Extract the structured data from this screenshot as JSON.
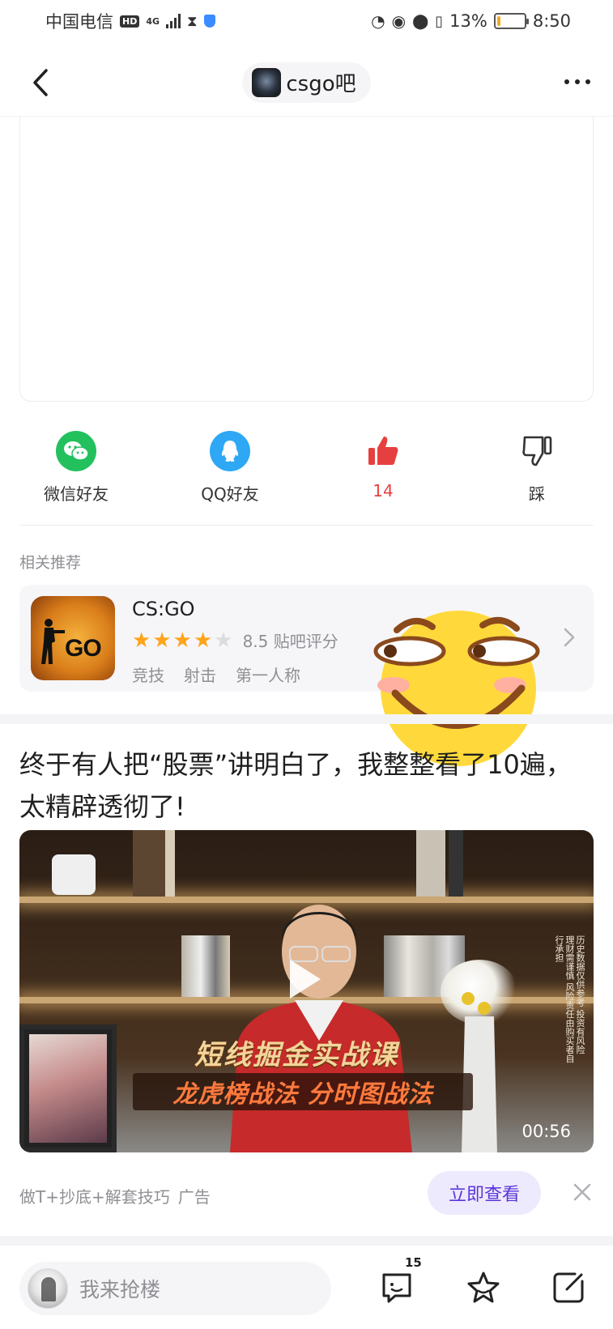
{
  "status_bar": {
    "carrier": "中国电信",
    "hd": "HD",
    "network": "4G",
    "battery_percent": "13%",
    "battery_level": 0.13,
    "time": "8:50"
  },
  "nav": {
    "forum_name": "csgo吧"
  },
  "share": {
    "wechat_label": "微信好友",
    "qq_label": "QQ好友",
    "like_count": "14",
    "dislike_label": "踩"
  },
  "related": {
    "section_label": "相关推荐",
    "game_title": "CS:GO",
    "game_icon_text": "GO",
    "rating_stars": 4,
    "rating_max": 5,
    "rating_text": "8.5 贴吧评分",
    "tags": [
      "竞技",
      "射击",
      "第一人称"
    ]
  },
  "ad": {
    "title": "终于有人把“股票”讲明白了，我整整看了10遍，太精辟透彻了!",
    "video_headline": "短线掘金实战课",
    "video_subline": "龙虎榜战法 分时图战法",
    "video_disclaimer": "历史数据仅供参考 投资有风险 理财需谨慎 风险责任由购买者自行承担",
    "duration": "00:56",
    "description": "做T+抄底+解套技巧",
    "ad_tag": "广告",
    "cta_label": "立即查看"
  },
  "input_bar": {
    "placeholder": "我来抢楼",
    "comment_count": "15"
  },
  "colors": {
    "like_red": "#e63f3f",
    "wechat_green": "#22c15e",
    "qq_blue": "#2ea8f5",
    "cta_purple": "#5a36d8",
    "star_orange": "#ffa41b"
  }
}
